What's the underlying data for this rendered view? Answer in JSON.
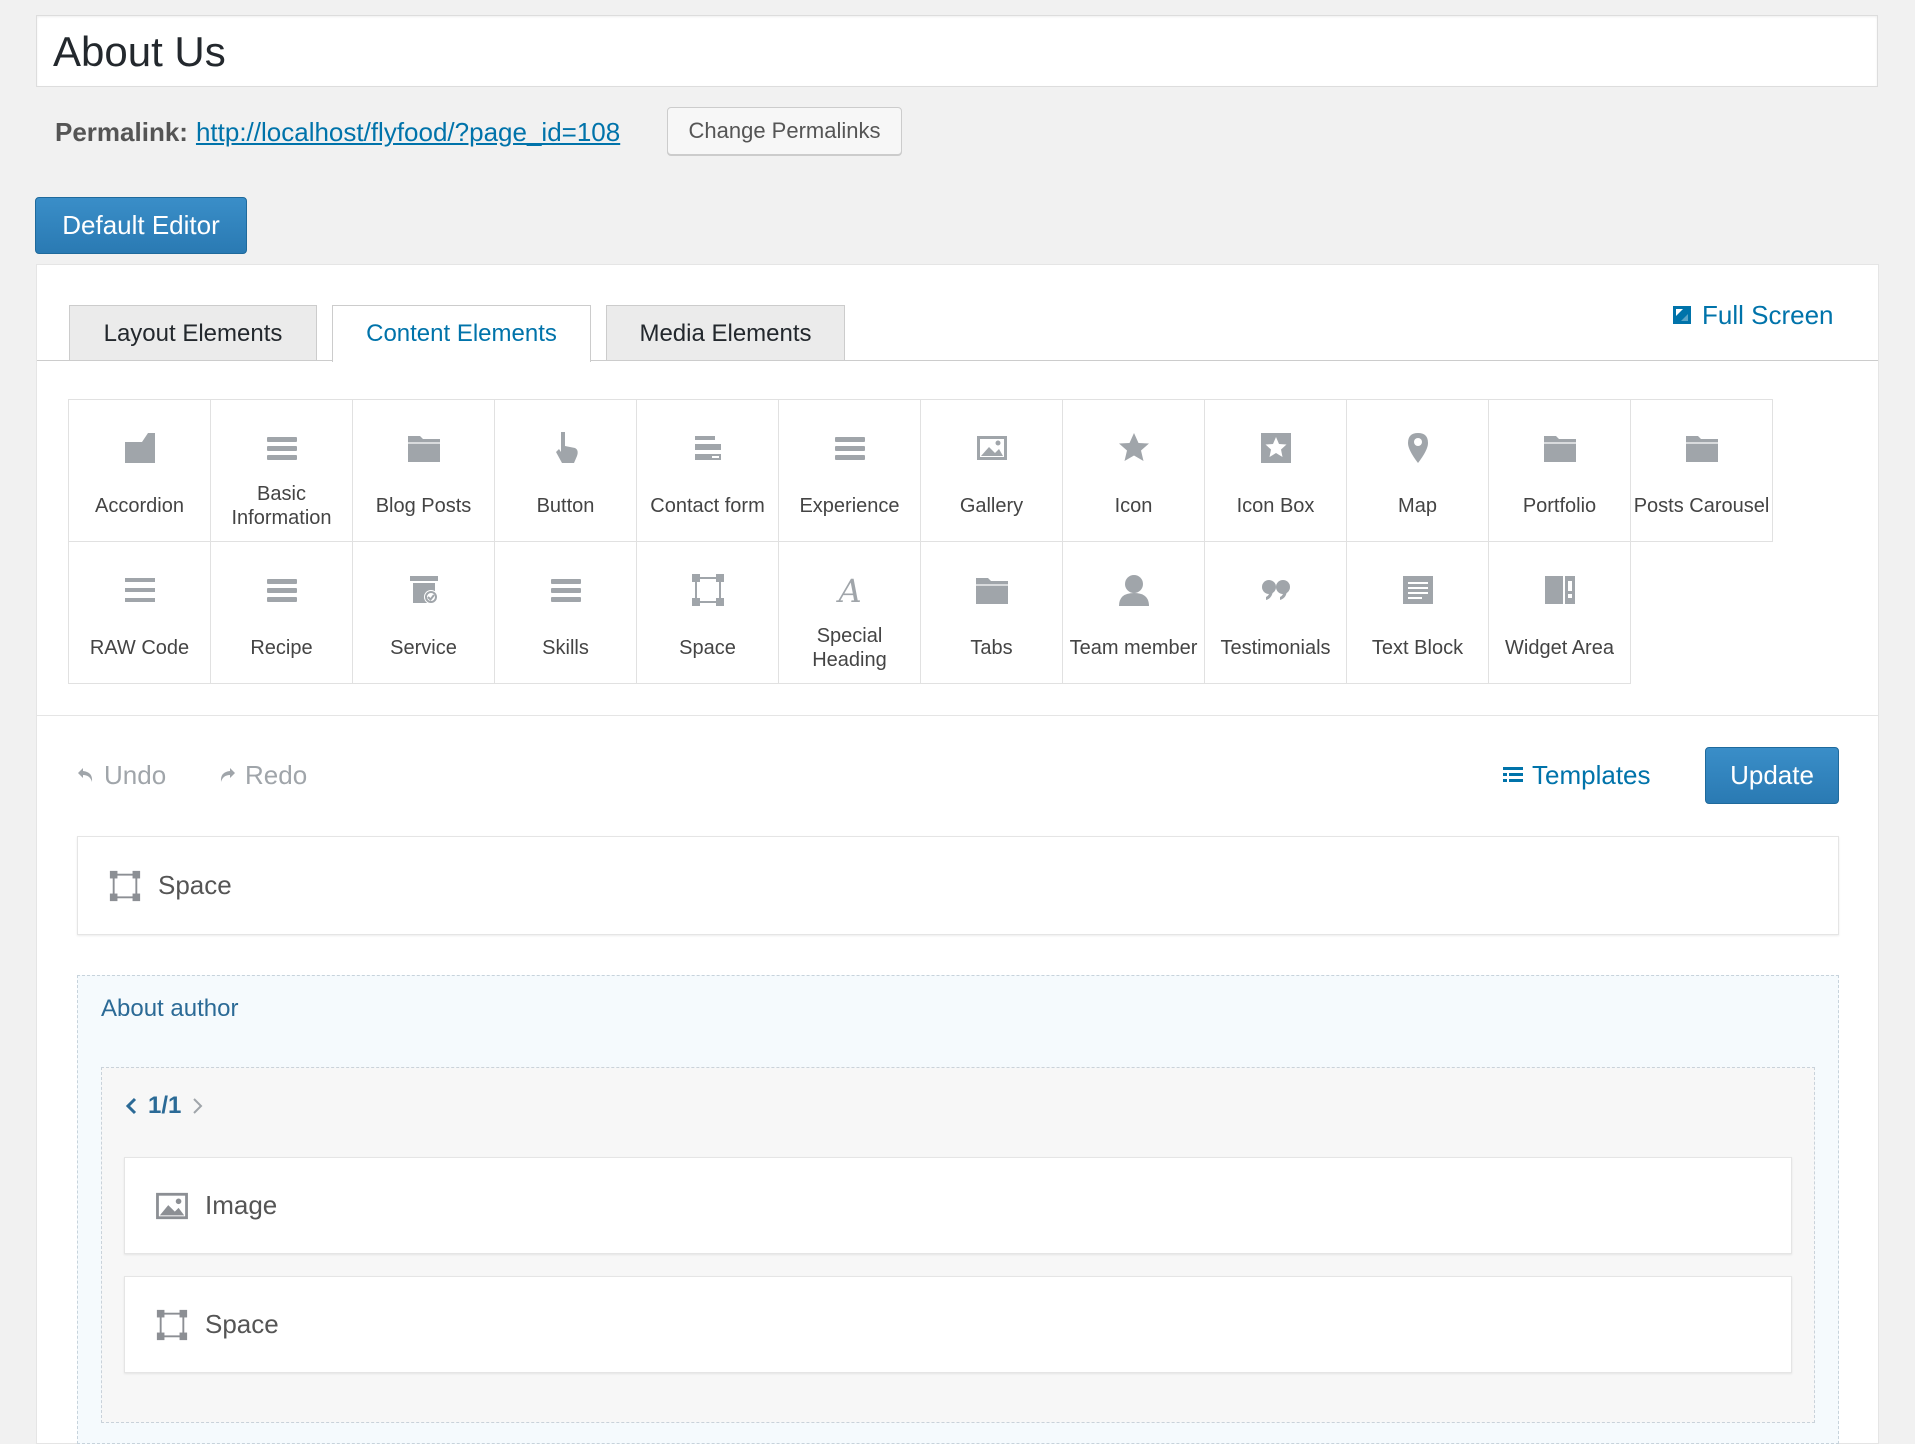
{
  "page": {
    "title": "About Us",
    "permalink_label": "Permalink:",
    "permalink_url": "http://localhost/flyfood/?page_id=108",
    "change_permalinks": "Change Permalinks",
    "default_editor": "Default Editor"
  },
  "tabs": [
    {
      "label": "Layout Elements",
      "active": false
    },
    {
      "label": "Content Elements",
      "active": true
    },
    {
      "label": "Media Elements",
      "active": false
    }
  ],
  "full_screen": "Full Screen",
  "elements_row1": [
    {
      "label": "Accordion",
      "icon": "accordion-icon"
    },
    {
      "label": "Basic Information",
      "icon": "list-icon"
    },
    {
      "label": "Blog Posts",
      "icon": "folder-icon"
    },
    {
      "label": "Button",
      "icon": "pointer-icon"
    },
    {
      "label": "Contact form",
      "icon": "form-icon"
    },
    {
      "label": "Experience",
      "icon": "list-icon"
    },
    {
      "label": "Gallery",
      "icon": "image-icon"
    },
    {
      "label": "Icon",
      "icon": "star-icon"
    },
    {
      "label": "Icon Box",
      "icon": "star-box-icon"
    },
    {
      "label": "Map",
      "icon": "map-pin-icon"
    },
    {
      "label": "Portfolio",
      "icon": "folder-icon"
    },
    {
      "label": "Posts Carousel",
      "icon": "folder-icon"
    }
  ],
  "elements_row2": [
    {
      "label": "RAW Code",
      "icon": "lines-icon"
    },
    {
      "label": "Recipe",
      "icon": "list-icon"
    },
    {
      "label": "Service",
      "icon": "service-icon"
    },
    {
      "label": "Skills",
      "icon": "list-icon"
    },
    {
      "label": "Space",
      "icon": "space-icon"
    },
    {
      "label": "Special Heading",
      "icon": "script-a-icon"
    },
    {
      "label": "Tabs",
      "icon": "folder-icon"
    },
    {
      "label": "Team member",
      "icon": "person-icon"
    },
    {
      "label": "Testimonials",
      "icon": "quote-icon"
    },
    {
      "label": "Text Block",
      "icon": "text-block-icon"
    },
    {
      "label": "Widget Area",
      "icon": "widget-icon"
    }
  ],
  "toolbar": {
    "undo": "Undo",
    "redo": "Redo",
    "templates": "Templates",
    "update": "Update"
  },
  "canvas": {
    "space_item": "Space",
    "section_title": "About author",
    "pager": "1/1",
    "image_item": "Image",
    "space_item_2": "Space"
  },
  "colors": {
    "accent": "#0073aa",
    "button_blue": "#2a7ab3",
    "icon_gray": "#a0a5aa"
  }
}
